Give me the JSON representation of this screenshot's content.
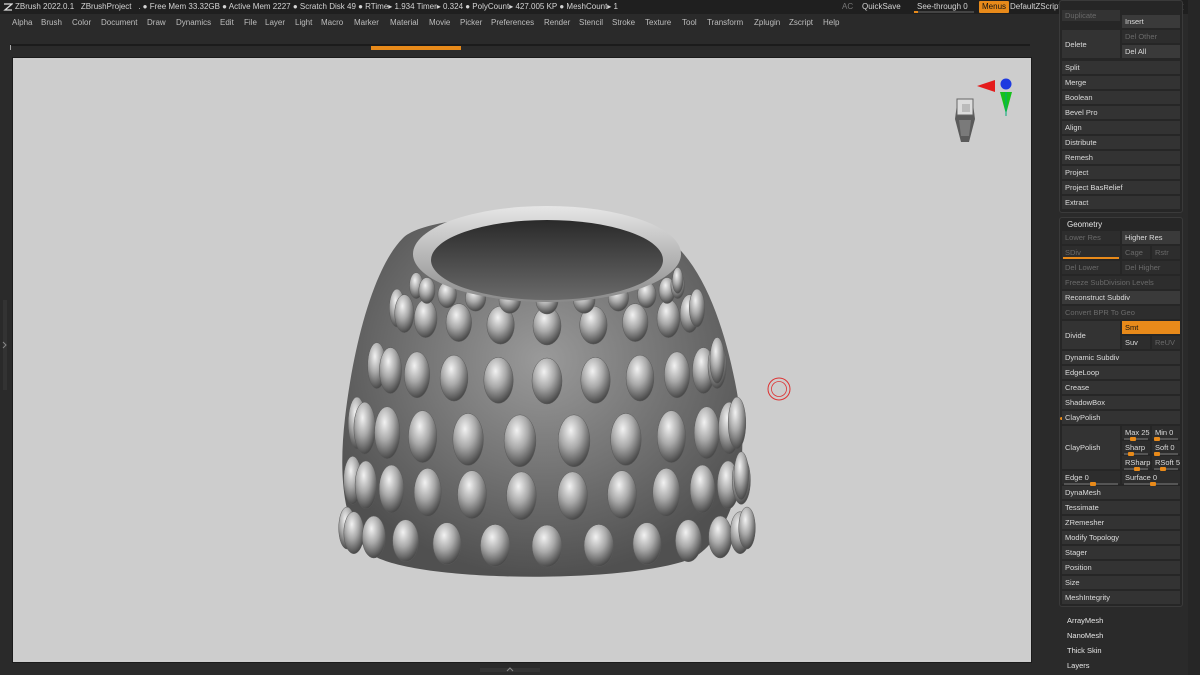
{
  "titlebar": {
    "app": "ZBrush 2022.0.1",
    "project": "ZBrushProject",
    "dot": ".",
    "stats": "● Free Mem 33.32GB ● Active Mem 2227 ● Scratch Disk 49 ● RTime▸ 1.934 Timer▸ 0.324 ● PolyCount▸ 427.005 KP  ● MeshCount▸ 1",
    "ac": "AC",
    "quicksave": "QuickSave",
    "seethrough": "See-through  0",
    "menus": "Menus",
    "defaultzscript": "DefaultZScript"
  },
  "menubar": [
    "Alpha",
    "Brush",
    "Color",
    "Document",
    "Draw",
    "Dynamics",
    "Edit",
    "File",
    "Layer",
    "Light",
    "Macro",
    "Marker",
    "Material",
    "Movie",
    "Picker",
    "Preferences",
    "Render",
    "Stencil",
    "Stroke",
    "Texture",
    "Tool",
    "Transform",
    "Zplugin",
    "Zscript",
    "Help"
  ],
  "tool_panel": {
    "duplicate": "Duplicate",
    "insert": "Insert",
    "delete": "Delete",
    "del_other": "Del Other",
    "del_all": "Del All",
    "items": [
      "Split",
      "Merge",
      "Boolean",
      "Bevel Pro",
      "Align",
      "Distribute",
      "Remesh",
      "Project",
      "Project BasRelief",
      "Extract"
    ]
  },
  "geometry": {
    "header": "Geometry",
    "lower_res": "Lower Res",
    "higher_res": "Higher Res",
    "sdiv": "SDiv",
    "cage": "Cage",
    "rstr": "Rstr",
    "del_lower": "Del Lower",
    "del_higher": "Del Higher",
    "freeze": "Freeze SubDivision Levels",
    "reconstruct": "Reconstruct Subdiv",
    "convert": "Convert BPR To Geo",
    "divide": "Divide",
    "smt": "Smt",
    "suv": "Suv",
    "reuv": "ReUV",
    "dynamic_subdiv": "Dynamic Subdiv",
    "edgeloop": "EdgeLoop",
    "crease": "Crease",
    "shadowbox": "ShadowBox",
    "claypolish_toggle": "ClayPolish",
    "claypolish_btn": "ClayPolish",
    "max": "Max 25",
    "min": "Min 0",
    "sharp": "Sharp",
    "soft": "Soft 0",
    "rsharp": "RSharp",
    "rsoft": "RSoft 5",
    "edge": "Edge 0",
    "surface": "Surface 0",
    "items": [
      "DynaMesh",
      "Tessimate",
      "ZRemesher",
      "Modify Topology",
      "Stager",
      "Position",
      "Size",
      "MeshIntegrity"
    ]
  },
  "subpalettes": [
    "ArrayMesh",
    "NanoMesh",
    "Thick Skin",
    "Layers"
  ],
  "colors": {
    "accent": "#e88a1a",
    "viewport_bg": "#cdcdcd",
    "panel_bg": "#2a2a2a"
  },
  "icons": {
    "app": "zbrush-logo-icon",
    "gizmo": "head-gizmo-icon",
    "cursor": "brush-cursor-icon"
  }
}
